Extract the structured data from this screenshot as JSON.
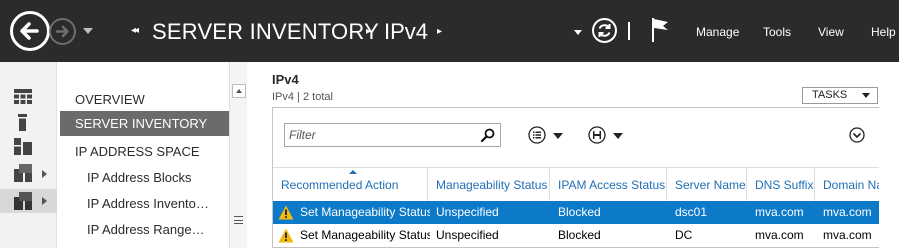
{
  "titlebar": {
    "breadcrumb": [
      "SERVER INVENTORY",
      "IPv4"
    ],
    "menu": [
      "Manage",
      "Tools",
      "View",
      "Help"
    ],
    "icons": [
      "back-arrow-icon",
      "forward-arrow-icon",
      "history-dropdown-icon",
      "refresh-icon",
      "flag-icon"
    ]
  },
  "rail": {
    "icons": [
      "dashboard-icon",
      "local-server-icon",
      "all-servers-icon",
      "file-services-icon",
      "ipam-icon"
    ]
  },
  "nav": {
    "items": [
      {
        "label": "OVERVIEW",
        "selected": false
      },
      {
        "label": "SERVER INVENTORY",
        "selected": true
      },
      {
        "label": "IP ADDRESS SPACE",
        "selected": false
      },
      {
        "label": "IP Address Blocks",
        "selected": false
      },
      {
        "label": "IP Address Invento…",
        "selected": false
      },
      {
        "label": "IP Address Range…",
        "selected": false
      }
    ]
  },
  "main": {
    "title": "IPv4",
    "subtitle": "IPv4 | 2 total",
    "tasks_label": "TASKS",
    "filter_placeholder": "Filter",
    "columns": [
      "Recommended Action",
      "Manageability Status",
      "IPAM Access Status",
      "Server Name",
      "DNS Suffix",
      "Domain Na"
    ],
    "rows": [
      {
        "action": "Set Manageability Status",
        "manageability": "Unspecified",
        "access": "Blocked",
        "server": "dsc01",
        "dns": "mva.com",
        "domain": "mva.com",
        "selected": true
      },
      {
        "action": "Set Manageability Status",
        "manageability": "Unspecified",
        "access": "Blocked",
        "server": "DC",
        "dns": "mva.com",
        "domain": "mva.com",
        "selected": false
      }
    ]
  },
  "colors": {
    "titlebar": "#2b2b2b",
    "selection": "#0d79c9",
    "link": "#1f6fb5",
    "warning": "#f2b90f"
  }
}
